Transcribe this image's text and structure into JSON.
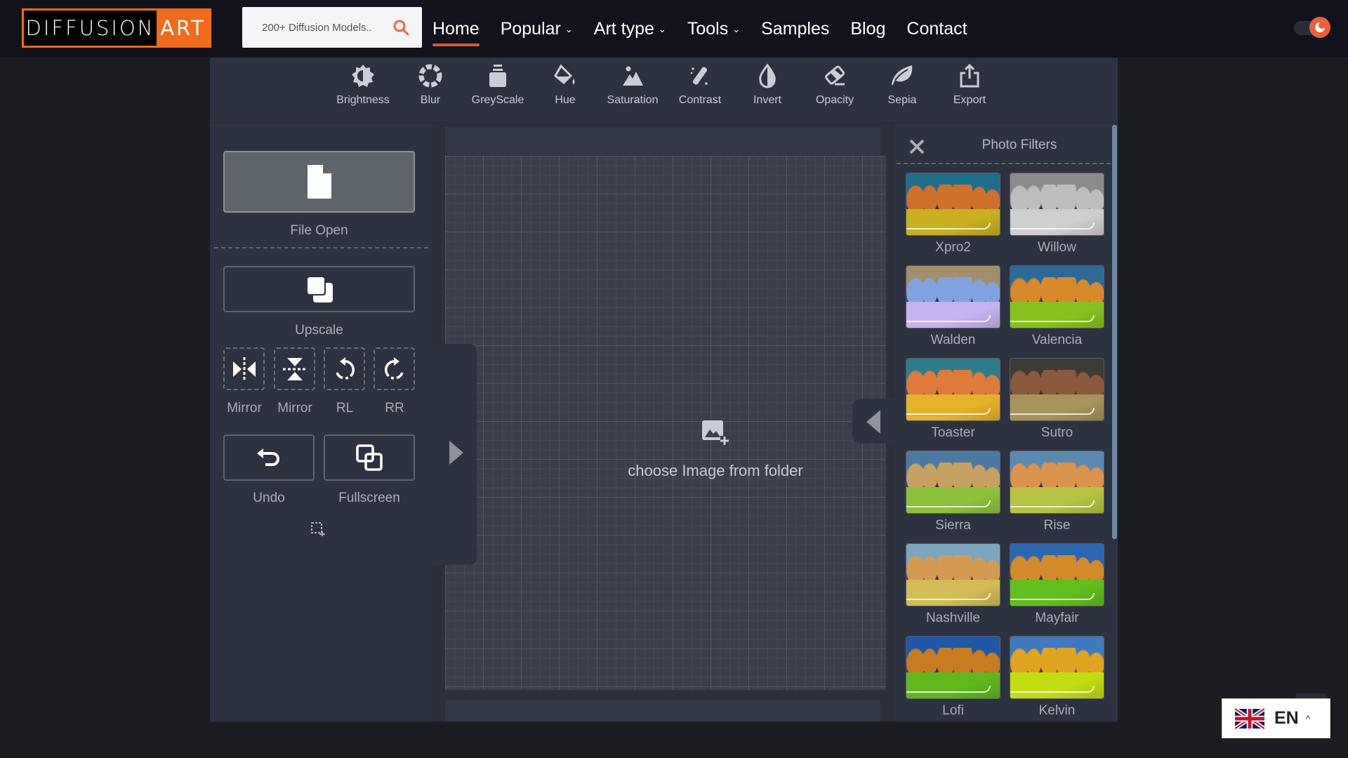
{
  "brand": {
    "name_part1": "DIFFUSION",
    "name_part2": "ART",
    "accent": "#f26a1b"
  },
  "search": {
    "placeholder": "200+ Diffusion Models..",
    "value": ""
  },
  "nav": {
    "items": [
      {
        "label": "Home",
        "active": true,
        "dropdown": false
      },
      {
        "label": "Popular",
        "active": false,
        "dropdown": true
      },
      {
        "label": "Art type",
        "active": false,
        "dropdown": true
      },
      {
        "label": "Tools",
        "active": false,
        "dropdown": true
      },
      {
        "label": "Samples",
        "active": false,
        "dropdown": false
      },
      {
        "label": "Blog",
        "active": false,
        "dropdown": false
      },
      {
        "label": "Contact",
        "active": false,
        "dropdown": false
      }
    ],
    "chevron": "⌄"
  },
  "theme_toggle": {
    "state": "dark"
  },
  "toolbar": {
    "tools": [
      {
        "label": "Brightness",
        "icon": "brightness-icon"
      },
      {
        "label": "Blur",
        "icon": "blur-icon"
      },
      {
        "label": "GreyScale",
        "icon": "greyscale-icon"
      },
      {
        "label": "Hue",
        "icon": "hue-icon"
      },
      {
        "label": "Saturation",
        "icon": "saturation-icon"
      },
      {
        "label": "Contrast",
        "icon": "contrast-icon"
      },
      {
        "label": "Invert",
        "icon": "invert-icon"
      },
      {
        "label": "Opacity",
        "icon": "opacity-icon"
      },
      {
        "label": "Sepia",
        "icon": "sepia-icon"
      },
      {
        "label": "Export",
        "icon": "export-icon"
      }
    ]
  },
  "left_panel": {
    "file_open": "File Open",
    "upscale": "Upscale",
    "transforms": [
      {
        "label": "Mirror",
        "icon": "mirror-horizontal-icon"
      },
      {
        "label": "Mirror",
        "icon": "mirror-vertical-icon"
      },
      {
        "label": "RL",
        "icon": "rotate-left-icon"
      },
      {
        "label": "RR",
        "icon": "rotate-right-icon"
      }
    ],
    "undo": "Undo",
    "fullscreen": "Fullscreen"
  },
  "canvas": {
    "prompt": "choose Image from folder"
  },
  "filters_panel": {
    "title": "Photo Filters",
    "filters": [
      {
        "name": "Xpro2",
        "sky": "#1d6e8c",
        "trees": "#d0702a",
        "field": "#c9b020"
      },
      {
        "name": "Willow",
        "sky": "#8a8a8a",
        "trees": "#bdbdbd",
        "field": "#cfcfcf"
      },
      {
        "name": "Walden",
        "sky": "#a28e6a",
        "trees": "#7fa3e0",
        "field": "#c6b2ee"
      },
      {
        "name": "Valencia",
        "sky": "#2c6a98",
        "trees": "#d78a2c",
        "field": "#86c21e"
      },
      {
        "name": "Toaster",
        "sky": "#2d7c8a",
        "trees": "#e07a3a",
        "field": "#e6b22a"
      },
      {
        "name": "Sutro",
        "sky": "#3b3c35",
        "trees": "#8a5a3c",
        "field": "#a8945a"
      },
      {
        "name": "Sierra",
        "sky": "#4a7aa2",
        "trees": "#c8a060",
        "field": "#8cc23a"
      },
      {
        "name": "Rise",
        "sky": "#5a8ab0",
        "trees": "#d9934c",
        "field": "#b6c442"
      },
      {
        "name": "Nashville",
        "sky": "#7aa6c0",
        "trees": "#d59a52",
        "field": "#d4bc54"
      },
      {
        "name": "Mayfair",
        "sky": "#2b66b0",
        "trees": "#d28a2a",
        "field": "#5fbf1d"
      },
      {
        "name": "Lofi",
        "sky": "#1f58a6",
        "trees": "#c97c1f",
        "field": "#5fb81c"
      },
      {
        "name": "Kelvin",
        "sky": "#3e7ac0",
        "trees": "#e2a320",
        "field": "#c2dc10"
      }
    ]
  },
  "language": {
    "code": "EN",
    "caret": "^"
  }
}
